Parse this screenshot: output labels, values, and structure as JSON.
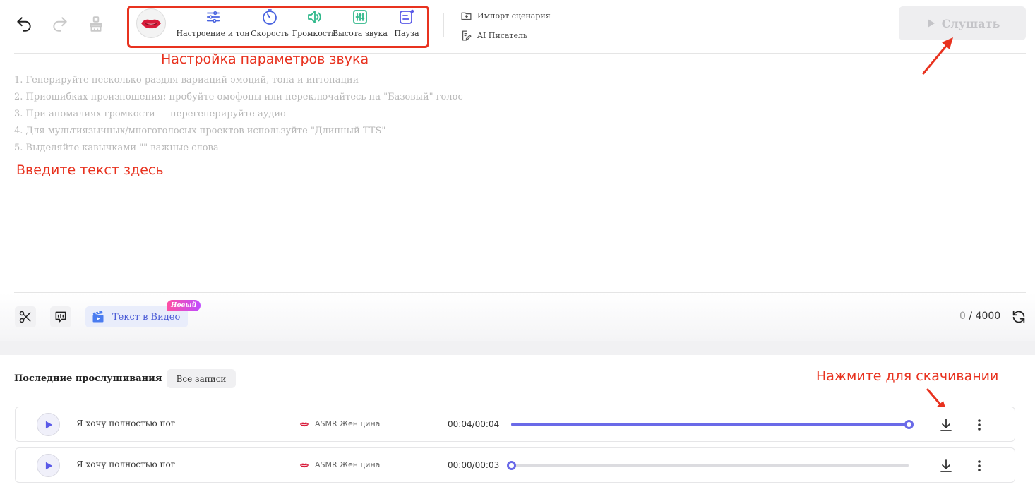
{
  "toolbar": {
    "tools": [
      {
        "label": "Настроение и тон",
        "icon": "sliders-icon"
      },
      {
        "label": "Скорость",
        "icon": "speedometer-icon"
      },
      {
        "label": "Громкость",
        "icon": "volume-icon"
      },
      {
        "label": "Высота звука",
        "icon": "pitch-icon"
      },
      {
        "label": "Пауза",
        "icon": "pause-icon"
      }
    ],
    "import_label": "Импорт сценария",
    "ai_writer_label": "AI Писатель",
    "listen_label": "Слушать"
  },
  "annotations": {
    "settings": "Настройка параметров звука",
    "enter_text": "Введите текст здесь",
    "download": "Нажмите для скачивании"
  },
  "editor": {
    "hints": [
      "1. Генерируйте несколько раздля вариаций эмоций, тона и интонации",
      "2. Приошибках произношения: пробуйте омофоны или переключайтесь на \"Базовый\" голос",
      "3. При аномалиях громкости — перегенерируйте аудио",
      "4. Для мультиязычных/многоголосых проектов используйте \"Длинный TTS\"",
      "5. Выделяйте кавычками \"\" важные слова"
    ]
  },
  "bottom_bar": {
    "text_to_video_label": "Текст в Видео",
    "new_badge": "Новый",
    "char_count": "0",
    "char_limit": "/ 4000"
  },
  "recent": {
    "title": "Последние прослушивания",
    "all_records_label": "Все записи",
    "items": [
      {
        "text": "Я хочу полностью пог",
        "voice": "ASMR Женщина",
        "time": "00:04/00:04",
        "progress": 1.0
      },
      {
        "text": "Я хочу полностью пог",
        "voice": "ASMR Женщина",
        "time": "00:00/00:03",
        "progress": 0.0
      }
    ]
  },
  "colors": {
    "accent": "#6a6ae8",
    "annotation": "#e8321f",
    "hint_text": "#b8b8b8"
  }
}
